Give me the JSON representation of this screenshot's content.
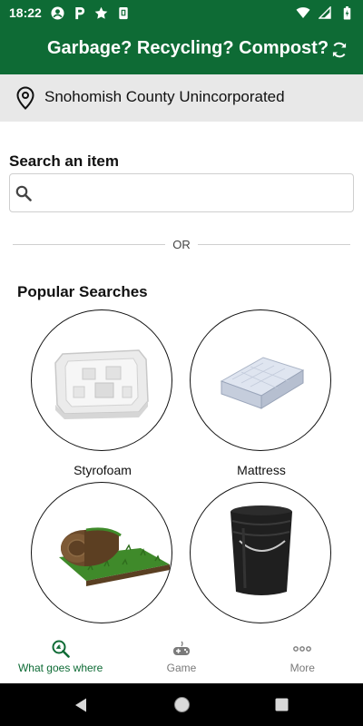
{
  "status_bar": {
    "time": "18:22",
    "left_icons": [
      "account-circle-icon",
      "parking-icon",
      "star-icon",
      "sim-card-icon"
    ],
    "right_icons": [
      "wifi-icon",
      "signal-icon",
      "battery-icon"
    ]
  },
  "app_bar": {
    "title": "Garbage? Recycling? Compost?",
    "action_icon": "refresh-icon",
    "background_color": "#0e6b35"
  },
  "location": {
    "icon": "map-pin-icon",
    "text": "Snohomish County Unincorporated"
  },
  "search": {
    "label": "Search an item",
    "placeholder": "",
    "value": "",
    "icon": "search-icon"
  },
  "divider": {
    "text": "OR"
  },
  "popular": {
    "title": "Popular Searches",
    "items": [
      {
        "label": "Styrofoam",
        "image": "styrofoam-packaging"
      },
      {
        "label": "Mattress",
        "image": "mattress"
      },
      {
        "label": "",
        "image": "sod-roll"
      },
      {
        "label": "",
        "image": "black-bucket"
      }
    ]
  },
  "bottom_nav": {
    "items": [
      {
        "label": "What goes where",
        "icon": "search-recycle-icon",
        "active": true
      },
      {
        "label": "Game",
        "icon": "gamepad-icon",
        "active": false
      },
      {
        "label": "More",
        "icon": "more-dots-icon",
        "active": false
      }
    ],
    "active_color": "#0e6b35"
  },
  "system_nav": {
    "buttons": [
      "back-icon",
      "home-icon",
      "recents-icon"
    ]
  }
}
